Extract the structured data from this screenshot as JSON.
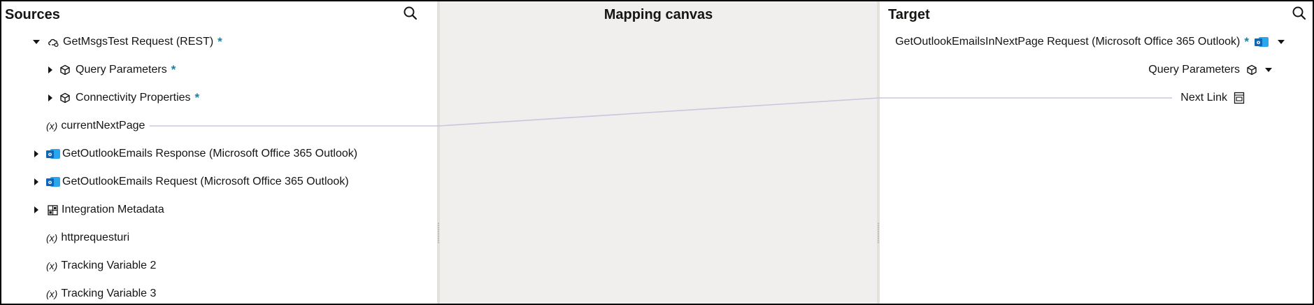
{
  "sources": {
    "title": "Sources",
    "items": [
      {
        "label": "GetMsgsTest Request (REST)",
        "required": "*"
      },
      {
        "label": "Query Parameters",
        "required": "*"
      },
      {
        "label": "Connectivity Properties",
        "required": "*"
      },
      {
        "label": "currentNextPage",
        "var": "(x)"
      },
      {
        "label": "GetOutlookEmails Response (Microsoft Office 365 Outlook)"
      },
      {
        "label": "GetOutlookEmails Request (Microsoft Office 365 Outlook)"
      },
      {
        "label": "Integration Metadata"
      },
      {
        "label": "httprequesturi",
        "var": "(x)"
      },
      {
        "label": "Tracking Variable 2",
        "var": "(x)"
      },
      {
        "label": "Tracking Variable 3",
        "var": "(x)"
      }
    ]
  },
  "canvas": {
    "title": "Mapping canvas"
  },
  "target": {
    "title": "Target",
    "items": [
      {
        "label": "GetOutlookEmailsInNextPage Request (Microsoft Office 365 Outlook)",
        "required": "*"
      },
      {
        "label": "Query Parameters"
      },
      {
        "label": "Next Link"
      }
    ]
  },
  "icons": {
    "search": "search-icon",
    "rest": "rest-cloud-icon",
    "schema": "schema-cube-icon",
    "outlook": "outlook-app-icon",
    "metadata": "metadata-grid-icon",
    "string_field": "string-field-icon",
    "expand": "caret-right-icon",
    "collapse": "caret-down-icon",
    "dropdown": "chevron-down-icon"
  },
  "colors": {
    "required": "#227e9e",
    "mapping_line": "#c9c6dd",
    "canvas_bg": "#f1efed",
    "outlook_dark": "#0f66b8",
    "outlook_light": "#28a8ea"
  }
}
